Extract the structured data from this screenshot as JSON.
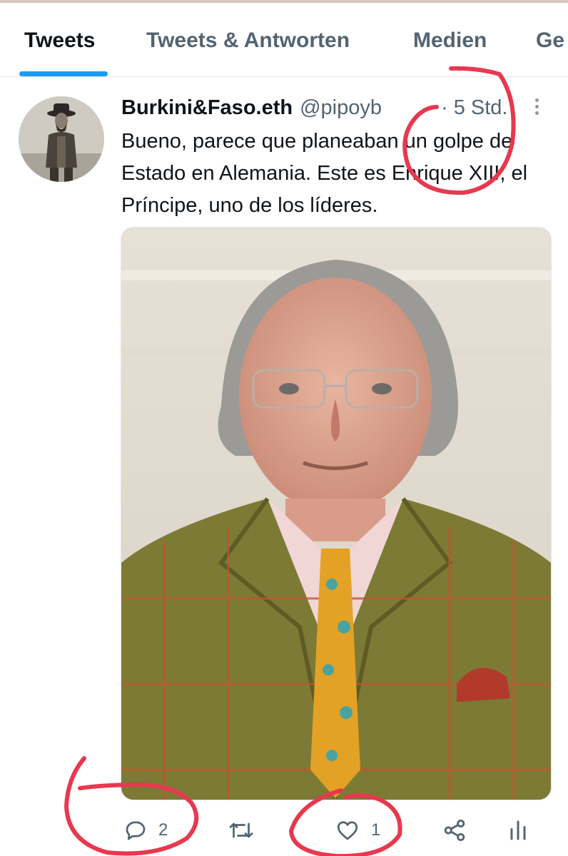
{
  "tabs": [
    {
      "label": "Tweets",
      "active": true
    },
    {
      "label": "Tweets & Antworten",
      "active": false
    },
    {
      "label": "Medien",
      "active": false
    },
    {
      "label": "Ge",
      "active": false
    }
  ],
  "tweet": {
    "display_name": "Burkini&Faso.eth",
    "handle": "@pipoyb",
    "time": "· 5 Std.",
    "text": "Bueno, parece que planeaban un golpe de Estado en Alemania. Este es Enrique XIII, el Príncipe, uno de los líderes.",
    "actions": {
      "reply_count": "2",
      "retweet_count": "",
      "like_count": "1"
    }
  },
  "icons": {
    "reply": "speech-bubble-icon",
    "retweet": "retweet-arrows-icon",
    "like": "heart-icon",
    "share": "share-nodes-icon",
    "analytics": "bar-chart-icon",
    "more": "vertical-dots-icon"
  },
  "colors": {
    "accent": "#1d9bf0",
    "secondary_text": "#536471",
    "annotation": "#e8384f"
  }
}
